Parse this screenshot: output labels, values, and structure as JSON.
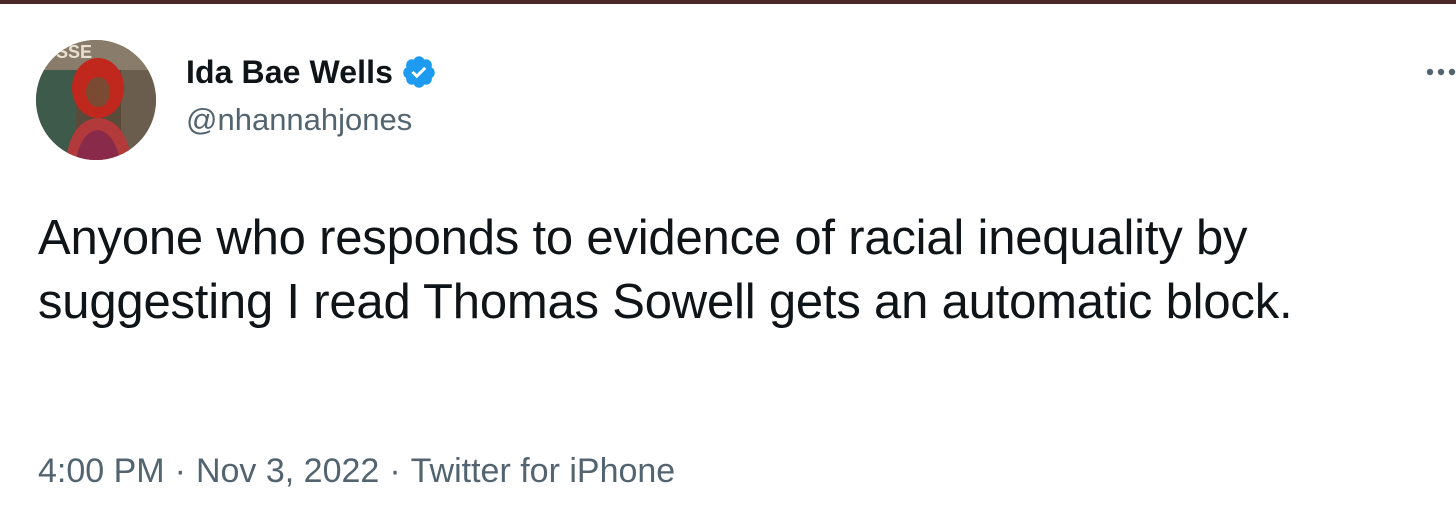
{
  "tweet": {
    "author": {
      "display_name": "Ida Bae Wells",
      "handle": "@nhannahjones",
      "verified": true,
      "avatar_icon": "profile-photo"
    },
    "text": "Anyone who responds to evidence of racial inequality by suggesting I read Thomas Sowell gets an automatic block.",
    "time": "4:00 PM",
    "separator": "·",
    "date": "Nov 3, 2022",
    "source": "Twitter for iPhone",
    "more_icon": "ellipsis-icon"
  },
  "colors": {
    "text_primary": "#0f1419",
    "text_secondary": "#536471",
    "verified_blue": "#1d9bf0",
    "background": "#ffffff"
  }
}
